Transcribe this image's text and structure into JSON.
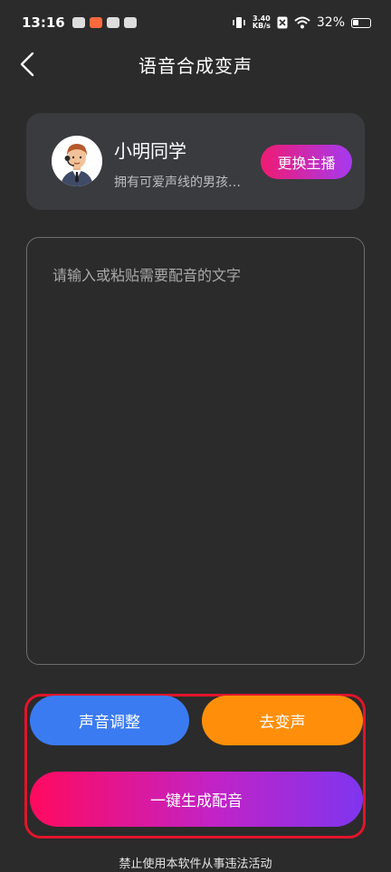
{
  "status_bar": {
    "time": "13:16",
    "net_speed_value": "3.40",
    "net_speed_unit": "KB/s",
    "battery_percent": "32%"
  },
  "header": {
    "title": "语音合成变声",
    "back_icon": "chevron-left-icon"
  },
  "anchor": {
    "name": "小明同学",
    "description": "拥有可爱声线的男孩…",
    "change_button": "更换主播"
  },
  "editor": {
    "placeholder": "请输入或粘贴需要配音的文字",
    "value": ""
  },
  "actions": {
    "voice_adjust": "声音调整",
    "remove_voice_change": "去变声",
    "generate": "一键生成配音"
  },
  "footer": {
    "note": "禁止使用本软件从事违法活动"
  },
  "colors": {
    "background": "#2b2b2b",
    "card": "#3a3b3f",
    "blue_button": "#3b7bf2",
    "orange_button": "#ff8f0a",
    "pink_gradient_start": "#ff0a5f",
    "purple_gradient_end": "#7f35ef",
    "highlight_frame": "#e0152b"
  }
}
